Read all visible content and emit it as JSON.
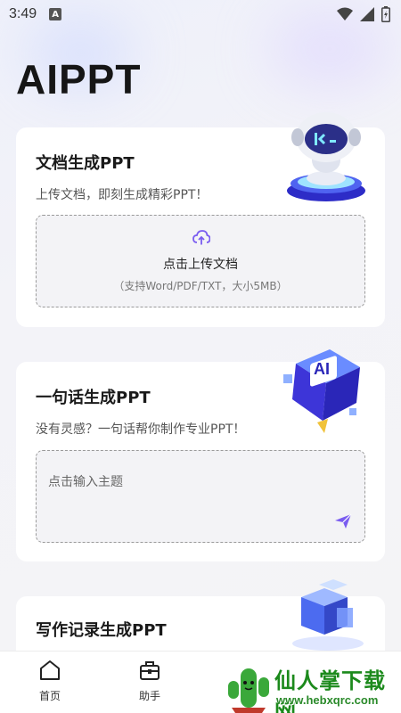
{
  "status_bar": {
    "time": "3:49",
    "notif_badge": "A"
  },
  "app": {
    "title": "AIPPT"
  },
  "doc_card": {
    "title": "文档生成PPT",
    "subtitle": "上传文档，即刻生成精彩PPT！",
    "upload_label": "点击上传文档",
    "upload_hint": "（支持Word/PDF/TXT，大小5MB）"
  },
  "sentence_card": {
    "title": "一句话生成PPT",
    "subtitle": "没有灵感？一句话帮你制作专业PPT！",
    "input_placeholder": "点击输入主题"
  },
  "notes_card": {
    "title": "写作记录生成PPT"
  },
  "tabs": [
    {
      "label": "首页",
      "icon": "home-icon"
    },
    {
      "label": "助手",
      "icon": "toolbox-icon"
    }
  ],
  "watermark": {
    "cn": "仙人掌下载网",
    "url": "www.hebxqrc.com"
  },
  "colors": {
    "accent": "#7a5cf0",
    "background": "#f4f4f6",
    "card": "#ffffff"
  }
}
